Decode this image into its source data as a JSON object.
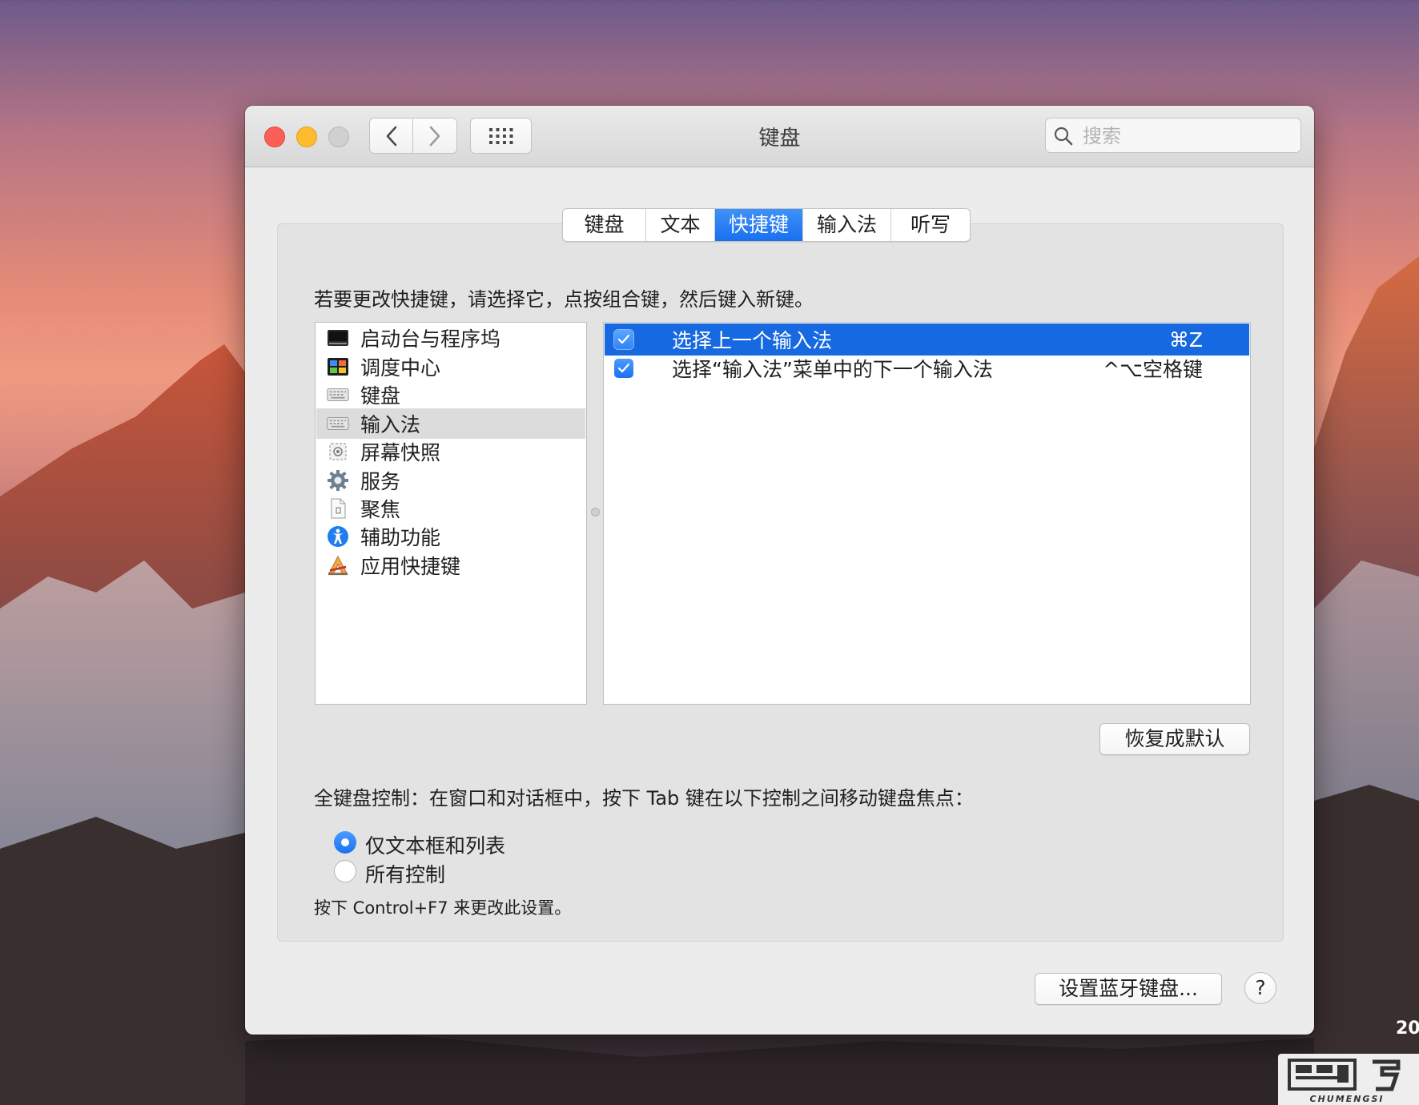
{
  "window": {
    "title": "键盘",
    "search_placeholder": "搜索"
  },
  "tabs": [
    {
      "label": "键盘",
      "active": false
    },
    {
      "label": "文本",
      "active": false
    },
    {
      "label": "快捷键",
      "active": true
    },
    {
      "label": "输入法",
      "active": false
    },
    {
      "label": "听写",
      "active": false
    }
  ],
  "instruction": "若要更改快捷键，请选择它，点按组合键，然后键入新键。",
  "categories": [
    {
      "label": "启动台与程序坞",
      "icon": "launchpad-icon"
    },
    {
      "label": "调度中心",
      "icon": "mission-control-icon"
    },
    {
      "label": "键盘",
      "icon": "keyboard-icon"
    },
    {
      "label": "输入法",
      "icon": "input-source-keyboard-icon",
      "selected": true
    },
    {
      "label": "屏幕快照",
      "icon": "screenshot-icon"
    },
    {
      "label": "服务",
      "icon": "gear-icon"
    },
    {
      "label": "聚焦",
      "icon": "spotlight-document-icon"
    },
    {
      "label": "辅助功能",
      "icon": "accessibility-icon"
    },
    {
      "label": "应用快捷键",
      "icon": "app-shortcuts-icon"
    }
  ],
  "shortcuts": [
    {
      "label": "选择上一个输入法",
      "key": "⌘Z",
      "checked": true,
      "selected": true
    },
    {
      "label": "选择“输入法”菜单中的下一个输入法",
      "key": "^⌥空格键",
      "checked": true,
      "selected": false
    }
  ],
  "restore_button": "恢复成默认",
  "full_keyboard_control": {
    "label": "全键盘控制：在窗口和对话框中，按下 Tab 键在以下控制之间移动键盘焦点：",
    "options": [
      {
        "label": "仅文本框和列表",
        "selected": true
      },
      {
        "label": "所有控制",
        "selected": false
      }
    ],
    "hint": "按下 Control+F7 来更改此设置。"
  },
  "bluetooth_button": "设置蓝牙键盘...",
  "help_button": "?",
  "desktop": {
    "corner_text": "20",
    "watermark_text": "CHUMENGSI"
  },
  "colors": {
    "accent": "#1669e0",
    "tab_active": "#2a7df4",
    "close": "#fc5f57",
    "minimize": "#fdbc2e"
  }
}
